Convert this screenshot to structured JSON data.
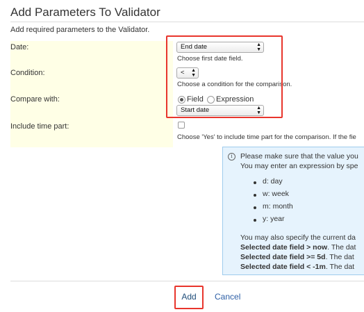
{
  "dialog": {
    "title": "Add Parameters To Validator",
    "description": "Add required parameters to the Validator."
  },
  "form": {
    "date_label": "Date:",
    "date_value": "End date",
    "date_help": "Choose first date field.",
    "condition_label": "Condition:",
    "condition_value": "<",
    "condition_help": "Choose a condition for the comparison.",
    "compare_label": "Compare with:",
    "compare_option_field": "Field",
    "compare_option_expression": "Expression",
    "compare_selected": "Field",
    "compare_value": "Start date",
    "time_part_label": "Include time part:",
    "time_part_checked": false,
    "time_part_help": "Choose 'Yes' to include time part for the comparison. If the fie"
  },
  "info": {
    "line1": "Please make sure that the value you",
    "line2": "You may enter an expression by spe",
    "bullets": [
      "d: day",
      "w: week",
      "m: month",
      "y: year"
    ],
    "line3": "You may also specify the current da",
    "examples": [
      {
        "bold": "Selected date field > now",
        "rest": ". The dat"
      },
      {
        "bold": "Selected date field >= 5d",
        "rest": ". The dat"
      },
      {
        "bold": "Selected date field < -1m",
        "rest": ". The dat"
      }
    ]
  },
  "footer": {
    "add_label": "Add",
    "cancel_label": "Cancel"
  },
  "colors": {
    "label_bg": "#ffffe6",
    "info_bg": "#e6f3fd",
    "highlight": "#e8352c",
    "link": "#2d5fa6"
  }
}
